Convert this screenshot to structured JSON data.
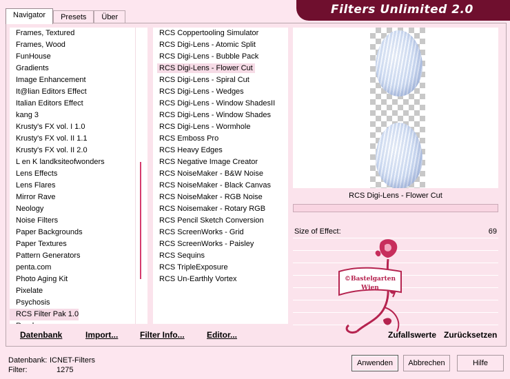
{
  "app": {
    "title": "Filters Unlimited 2.0"
  },
  "tabs": [
    {
      "label": "Navigator",
      "active": true
    },
    {
      "label": "Presets",
      "active": false
    },
    {
      "label": "Über",
      "active": false
    }
  ],
  "categories": {
    "items": [
      "Frames, Textured",
      "Frames, Wood",
      "FunHouse",
      "Gradients",
      "Image Enhancement",
      "It@lian Editors Effect",
      "Italian Editors Effect",
      "kang 3",
      "Krusty's FX vol. I 1.0",
      "Krusty's FX vol. II 1.1",
      "Krusty's FX vol. II 2.0",
      "L en K landksiteofwonders",
      "Lens Effects",
      "Lens Flares",
      "Mirror Rave",
      "Neology",
      "Noise Filters",
      "Paper Backgrounds",
      "Paper Textures",
      "Pattern Generators",
      "penta.com",
      "Photo Aging Kit",
      "Pixelate",
      "Psychosis",
      "RCS Filter Pak 1.0",
      "Render"
    ],
    "selected_index": 24
  },
  "filters": {
    "items": [
      "RCS Coppertooling Simulator",
      "RCS Digi-Lens - Atomic Split",
      "RCS Digi-Lens - Bubble Pack",
      "RCS Digi-Lens - Flower Cut",
      "RCS Digi-Lens - Spiral Cut",
      "RCS Digi-Lens - Wedges",
      "RCS Digi-Lens - Window ShadesII",
      "RCS Digi-Lens - Window Shades",
      "RCS Digi-Lens - Wormhole",
      "RCS Emboss Pro",
      "RCS Heavy Edges",
      "RCS Negative Image Creator",
      "RCS NoiseMaker - B&W Noise",
      "RCS NoiseMaker - Black Canvas",
      "RCS NoiseMaker - RGB Noise",
      "RCS Noisemaker - Rotary RGB",
      "RCS Pencil Sketch Conversion",
      "RCS ScreenWorks - Grid",
      "RCS ScreenWorks - Paisley",
      "RCS Sequins",
      "RCS TripleExposure",
      "RCS Un-Earthly Vortex"
    ],
    "selected_index": 3
  },
  "preview": {
    "filter_name": "RCS Digi-Lens - Flower Cut"
  },
  "parameters": [
    {
      "label": "Size of Effect:",
      "value": "69"
    }
  ],
  "watermark": {
    "text_line1": "©Bastelgarten",
    "text_line2": "Wien"
  },
  "bottom_links": {
    "database": "Datenbank",
    "import": "Import...",
    "filter_info": "Filter Info...",
    "editor": "Editor...",
    "random": "Zufallswerte",
    "reset": "Zurücksetzen"
  },
  "status": {
    "database_label": "Datenbank:",
    "database_value": "ICNET-Filters",
    "filter_label": "Filter:",
    "filter_value": "1275"
  },
  "buttons": {
    "apply": "Anwenden",
    "cancel": "Abbrechen",
    "help": "Hilfe"
  }
}
